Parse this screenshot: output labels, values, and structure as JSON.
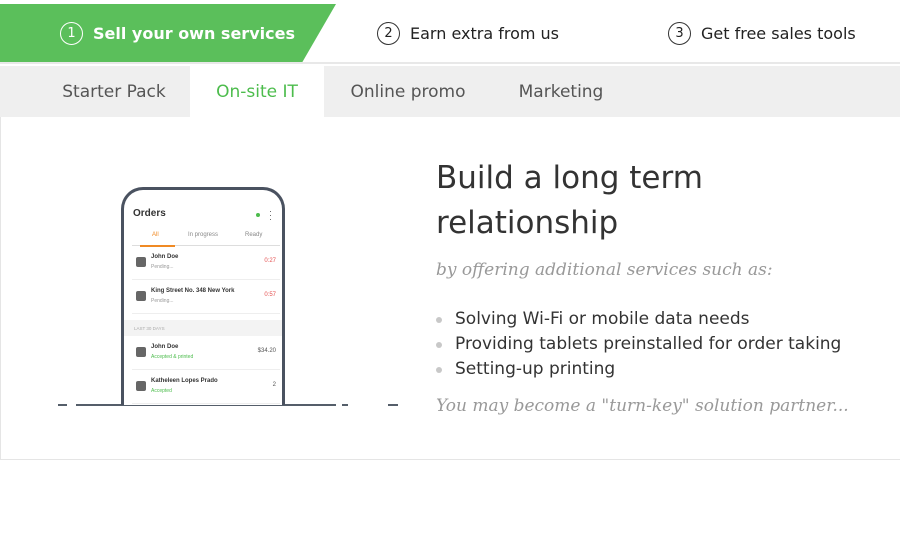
{
  "steps": [
    {
      "num": "1",
      "label": "Sell your own services",
      "active": true
    },
    {
      "num": "2",
      "label": "Earn extra from us",
      "active": false
    },
    {
      "num": "3",
      "label": "Get free sales tools",
      "active": false
    }
  ],
  "tabs": [
    {
      "label": "Starter Pack",
      "active": false
    },
    {
      "label": "On-site IT",
      "active": true
    },
    {
      "label": "Online promo",
      "active": false
    },
    {
      "label": "Marketing",
      "active": false
    }
  ],
  "colors": {
    "accent": "#5bbf5b",
    "tab_active_text": "#4cbc4c",
    "tab_bg": "#efefef"
  },
  "phone": {
    "title": "Orders",
    "tabs": [
      "All",
      "In progress",
      "Ready"
    ],
    "rows": [
      {
        "name": "John Doe",
        "sub": "Pending...",
        "right": "0:27",
        "icon": "restaurant-icon"
      },
      {
        "name": "King Street No. 348 New York",
        "sub": "Pending...",
        "right": "0:57",
        "icon": "delivery-icon"
      },
      {
        "name": "John Doe",
        "sub": "Accepted & printed",
        "right": "$34.20",
        "icon": "restaurant-icon"
      },
      {
        "name": "Katheleen Lopes Prado",
        "sub": "Accepted",
        "right": "2",
        "icon": "table-icon"
      }
    ],
    "section_label": "LAST 30 DAYS"
  },
  "content": {
    "headline": "Build a long term relationship",
    "lead": "by offering additional services such as:",
    "bullets": [
      "Solving Wi-Fi or mobile data needs",
      "Providing tablets preinstalled for order taking",
      "Setting-up printing"
    ],
    "closing": "You may become a \"turn-key\" solution partner..."
  }
}
